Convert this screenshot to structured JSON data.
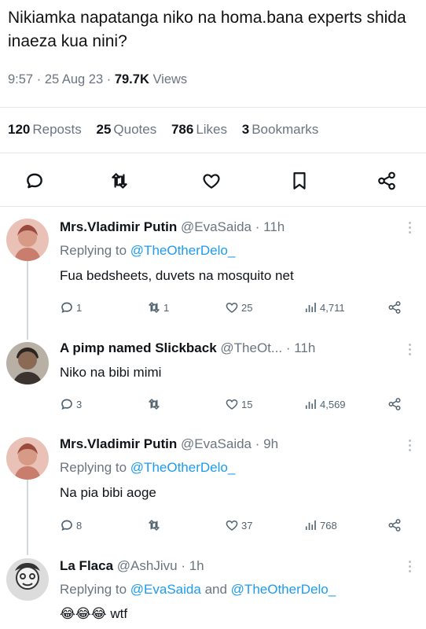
{
  "tweet": {
    "text": "Nikiamka napatanga niko na homa.bana experts shida inaeza kua nini?",
    "time": "9:57",
    "date": "25 Aug 23",
    "views_count": "79.7K",
    "views_label": "Views",
    "separator": "·"
  },
  "stats": [
    {
      "count": "120",
      "label": "Reposts"
    },
    {
      "count": "25",
      "label": "Quotes"
    },
    {
      "count": "786",
      "label": "Likes"
    },
    {
      "count": "3",
      "label": "Bookmarks"
    }
  ],
  "action_icons": [
    "reply-icon",
    "repost-icon",
    "like-icon",
    "bookmark-icon",
    "share-icon"
  ],
  "replies": [
    {
      "name": "Mrs.Vladimir Putin",
      "handle": "@EvaSaida",
      "time": "· 11h",
      "replying_prefix": "Replying to",
      "replying_to": "@TheOtherDelo_",
      "replying_joiner": "",
      "replying_to_2": "",
      "text": "Fua bedsheets, duvets na mosquito net",
      "replies": "1",
      "reposts": "1",
      "likes": "25",
      "views": "4,711"
    },
    {
      "name": "A pimp named Slickback",
      "handle": "@TheOt...",
      "time": "· 11h",
      "replying_prefix": "",
      "replying_to": "",
      "replying_joiner": "",
      "replying_to_2": "",
      "text": "Niko na bibi mimi",
      "replies": "3",
      "reposts": "",
      "likes": "15",
      "views": "4,569"
    },
    {
      "name": "Mrs.Vladimir Putin",
      "handle": "@EvaSaida",
      "time": "· 9h",
      "replying_prefix": "Replying to",
      "replying_to": "@TheOtherDelo_",
      "replying_joiner": "",
      "replying_to_2": "",
      "text": "Na pia bibi aoge",
      "replies": "8",
      "reposts": "",
      "likes": "37",
      "views": "768"
    },
    {
      "name": "La Flaca",
      "handle": "@AshJivu",
      "time": "· 1h",
      "replying_prefix": "Replying to",
      "replying_to": "@EvaSaida",
      "replying_joiner": "and",
      "replying_to_2": "@TheOtherDelo_",
      "text": "😂😂😂 wtf",
      "replies": "",
      "reposts": "",
      "likes": "",
      "views": ""
    }
  ],
  "colors": {
    "text": "#0f1419",
    "muted": "#6b7580",
    "link": "#1d9bf0",
    "divider": "#e4e8eb",
    "thread_line": "#cfd9de"
  }
}
